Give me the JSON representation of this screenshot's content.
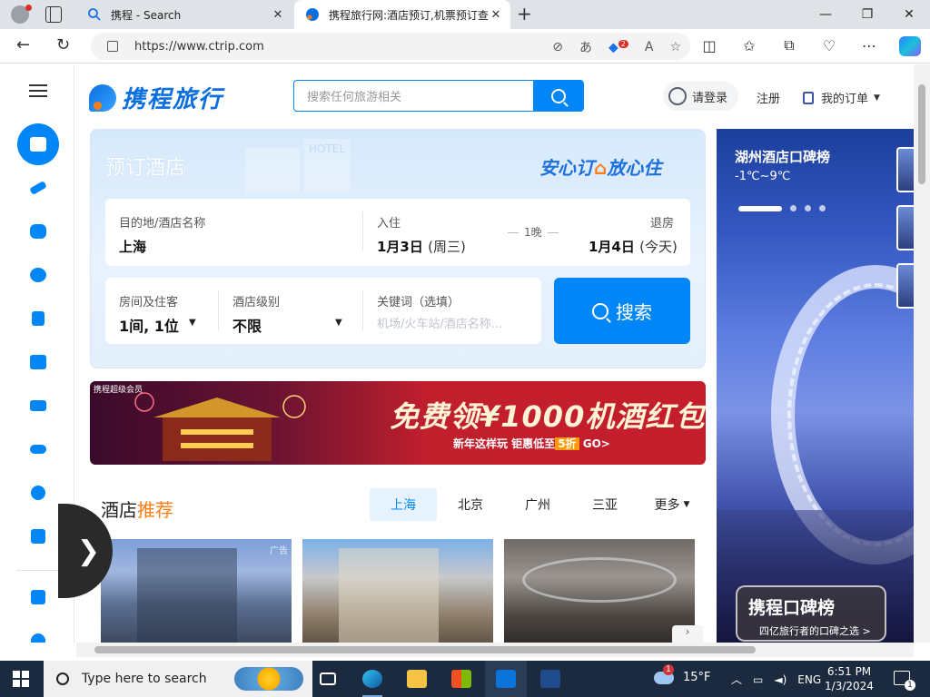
{
  "browser": {
    "tabs": [
      {
        "title": "携程 - Search"
      },
      {
        "title": "携程旅行网:酒店预订,机票预订查"
      }
    ],
    "url": "https://www.ctrip.com",
    "badge_count": "2"
  },
  "header": {
    "logo_text": "携程旅行",
    "search_placeholder": "搜索任何旅游相关",
    "login": "请登录",
    "register": "注册",
    "orders": "我的订单"
  },
  "booking": {
    "title": "预订酒店",
    "slogan_part1": "安心订",
    "slogan_part2": "放心住",
    "destination_label": "目的地/酒店名称",
    "destination_value": "上海",
    "checkin_label": "入住",
    "checkin_date": "1月3日",
    "checkin_weekday": "(周三)",
    "nights": "1晚",
    "checkout_label": "退房",
    "checkout_date": "1月4日",
    "checkout_weekday": "(今天)",
    "rooms_label": "房间及住客",
    "rooms_value": "1间, 1位",
    "star_label": "酒店级别",
    "star_value": "不限",
    "keyword_label": "关键词（选填）",
    "keyword_placeholder": "机场/火车站/酒店名称...",
    "search_button": "搜索"
  },
  "promo": {
    "tag": "携程超级会员",
    "main": "免费领¥1000机酒红包",
    "sub_prefix": "新年这样玩 钜惠低至",
    "sub_highlight": "5折",
    "sub_suffix": "GO>"
  },
  "recommend": {
    "title_part1": "酒店",
    "title_part2": "推荐",
    "cities": [
      "上海",
      "北京",
      "广州",
      "三亚",
      "更多"
    ],
    "ad_label": "广告"
  },
  "right_panel": {
    "title": "湖州酒店口碑榜",
    "temperature": "-1℃~9℃",
    "badge_title": "携程口碑榜",
    "badge_sub": "四亿旅行者的口碑之选 >"
  },
  "taskbar": {
    "search_text": "Type here to search",
    "weather": "15°F",
    "lang": "ENG",
    "time": "6:51 PM",
    "date": "1/3/2024"
  },
  "colors": {
    "brand_blue": "#0086f6",
    "brand_orange": "#ff7d13"
  }
}
